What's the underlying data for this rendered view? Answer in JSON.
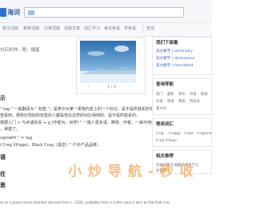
{
  "header": {
    "logo_text": "海词",
    "search_value": "",
    "brand_color": "#2f6fd0"
  },
  "nav": {
    "items": [
      "英汉词典",
      "英英词典",
      "汉英词典",
      "词典文章",
      "词汇学习",
      "每日英语",
      "学英语",
      "查词"
    ]
  },
  "main": {
    "subline": "白石岭种，随：播塞",
    "pager": {
      "prev": "‹",
      "label": "1 / 2",
      "next": "›"
    },
    "section_1": "示",
    "paragraphs": [
      "\" tag \" 一般翻译为 \" 标签 \"，是表示对某一事物内容上的一个标记，是不是所载系的领域，",
      "查看到，那些比较好的标签的人都是他在这样的对比得到的，是不是所载系的。",
      "根据入门 + 与术语有关 + g (作者为：世界) \" 一篇人更多语、摩统、作者，一来可用自己的",
      "，得建了。",
      "ugrowth \" = tag",
      "l Crag Village)、Black Crag（黑岩）\" 户外产品品牌。"
    ],
    "section_2": "语",
    "section_3": "在",
    "section_4": "思",
    "footer_line": "m as a place-name element derived from c. 1200, probably from a Celtic source akin to Old Irish crec"
  },
  "sidebar": {
    "dict_title": "我们下面看",
    "dict_links": [
      "说文解字 | dictionary",
      "说文解字 | dominance",
      "说文解字 | translated"
    ],
    "cat_title": "查询导航",
    "cat_chips": [
      "热门",
      "最新",
      "英文",
      "日语",
      "韩语",
      "法语",
      "德语",
      "俄语",
      "西班牙",
      "意大利"
    ],
    "rel_title": "常用词汇",
    "rel_chips": [
      "crag",
      "craggy",
      "crags",
      "cragsman",
      "Crag Village"
    ],
    "more_title": "相关推荐",
    "more_chips": [
      "英语词典",
      "在线翻译",
      "英语学习",
      "双语例句"
    ]
  },
  "watermark": "小 炒 导 航 - 秒 收"
}
